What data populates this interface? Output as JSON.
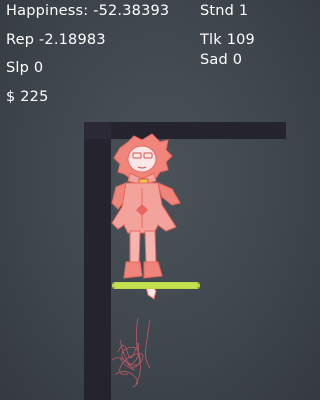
{
  "stats": {
    "happiness": "Happiness: -52.38393",
    "rep": "Rep -2.18983",
    "slp": "Slp 0",
    "money": "$ 225",
    "stnd": "Stnd 1",
    "tlk": "Tlk 109",
    "sad": "Sad 0"
  },
  "character": {
    "icon": "pink-humanoid-character",
    "color": "#f0857c",
    "outline": "#e8685f"
  },
  "health_bar": {
    "level": 1.0,
    "color": "#c4e04c"
  },
  "colors": {
    "background": "#434a51",
    "wall": "#25232e"
  }
}
